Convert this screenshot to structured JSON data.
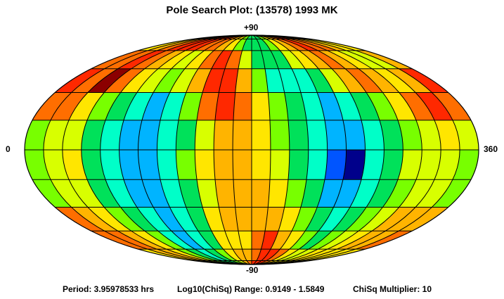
{
  "chart_data": {
    "type": "heatmap",
    "projection": "aitoff (elliptical all-sky)",
    "title": "Pole Search Plot: (13578) 1993 MK",
    "x_axis": {
      "min_label": "0",
      "max_label": "360",
      "range": [
        0,
        360
      ]
    },
    "y_axis": {
      "top_label": "+90",
      "bottom_label": "-90",
      "range": [
        -90,
        90
      ]
    },
    "grid": true,
    "lambda_step_deg": 15,
    "beta_step_deg": 15,
    "beta_bands": [
      90,
      75,
      60,
      45,
      30,
      15,
      0,
      -15,
      -30,
      -45,
      -60,
      -75,
      -90
    ],
    "color_scale": [
      "#00008b",
      "#0055ff",
      "#00b4ff",
      "#00ffc8",
      "#00e15a",
      "#78ff00",
      "#d8ff00",
      "#ffe600",
      "#ffb400",
      "#ff6e00",
      "#ff2800",
      "#8b0000"
    ],
    "color_scale_meaning": "0 = lowest ChiSq (blue), 11 = highest ChiSq (dark red)",
    "rows": [
      [
        7,
        7,
        8,
        9,
        10,
        10,
        10,
        9,
        8,
        7,
        5,
        4,
        4,
        4,
        5,
        7,
        8,
        9,
        10,
        10,
        9,
        8,
        7,
        7
      ],
      [
        7,
        8,
        9,
        10,
        10,
        10,
        9,
        9,
        8,
        7,
        5,
        4,
        4,
        4,
        5,
        7,
        8,
        9,
        10,
        9,
        9,
        8,
        7,
        7
      ],
      [
        9,
        9,
        10,
        9,
        8,
        7,
        6,
        7,
        9,
        10,
        9,
        6,
        4,
        4,
        4,
        6,
        7,
        8,
        9,
        8,
        7,
        6,
        6,
        8
      ],
      [
        10,
        9,
        11,
        9,
        7,
        6,
        5,
        6,
        8,
        10,
        10,
        8,
        5,
        3,
        3,
        3,
        4,
        6,
        8,
        9,
        8,
        7,
        8,
        10
      ],
      [
        9,
        9,
        7,
        5,
        4,
        3,
        2,
        3,
        5,
        9,
        10,
        9,
        7,
        5,
        4,
        3,
        2,
        3,
        4,
        5,
        7,
        9,
        10,
        9
      ],
      [
        5,
        6,
        6,
        4,
        3,
        2,
        2,
        3,
        4,
        6,
        8,
        8,
        7,
        5,
        4,
        3,
        2,
        2,
        3,
        4,
        5,
        6,
        7,
        6
      ],
      [
        5,
        6,
        7,
        4,
        3,
        2,
        2,
        3,
        5,
        7,
        8,
        8,
        7,
        6,
        4,
        3,
        1,
        0,
        3,
        4,
        6,
        6,
        6,
        5
      ],
      [
        5,
        6,
        6,
        4,
        3,
        2,
        2,
        3,
        4,
        6,
        8,
        8,
        8,
        7,
        5,
        4,
        2,
        2,
        3,
        4,
        5,
        6,
        6,
        5
      ],
      [
        9,
        8,
        7,
        5,
        4,
        3,
        2,
        3,
        4,
        7,
        8,
        8,
        8,
        8,
        7,
        5,
        4,
        3,
        4,
        5,
        6,
        8,
        8,
        8
      ],
      [
        9,
        9,
        8,
        7,
        5,
        3,
        2,
        3,
        4,
        7,
        7,
        7,
        9,
        10,
        8,
        7,
        5,
        4,
        5,
        6,
        7,
        8,
        8,
        9
      ],
      [
        7,
        8,
        8,
        7,
        5,
        4,
        3,
        4,
        5,
        7,
        8,
        8,
        9,
        10,
        10,
        9,
        7,
        6,
        6,
        7,
        7,
        7,
        7,
        7
      ],
      [
        7,
        7,
        7,
        6,
        5,
        4,
        4,
        4,
        5,
        6,
        8,
        9,
        10,
        10,
        10,
        9,
        8,
        7,
        7,
        7,
        7,
        7,
        7,
        7
      ]
    ]
  },
  "labels": {
    "left": "0",
    "right": "360",
    "top": "+90",
    "bottom": "-90"
  },
  "footer": {
    "period": "Period: 3.95978533 hrs",
    "range": "Log10(ChiSq) Range: 0.9149 - 1.5849",
    "multiplier": "ChiSq Multiplier: 10"
  }
}
